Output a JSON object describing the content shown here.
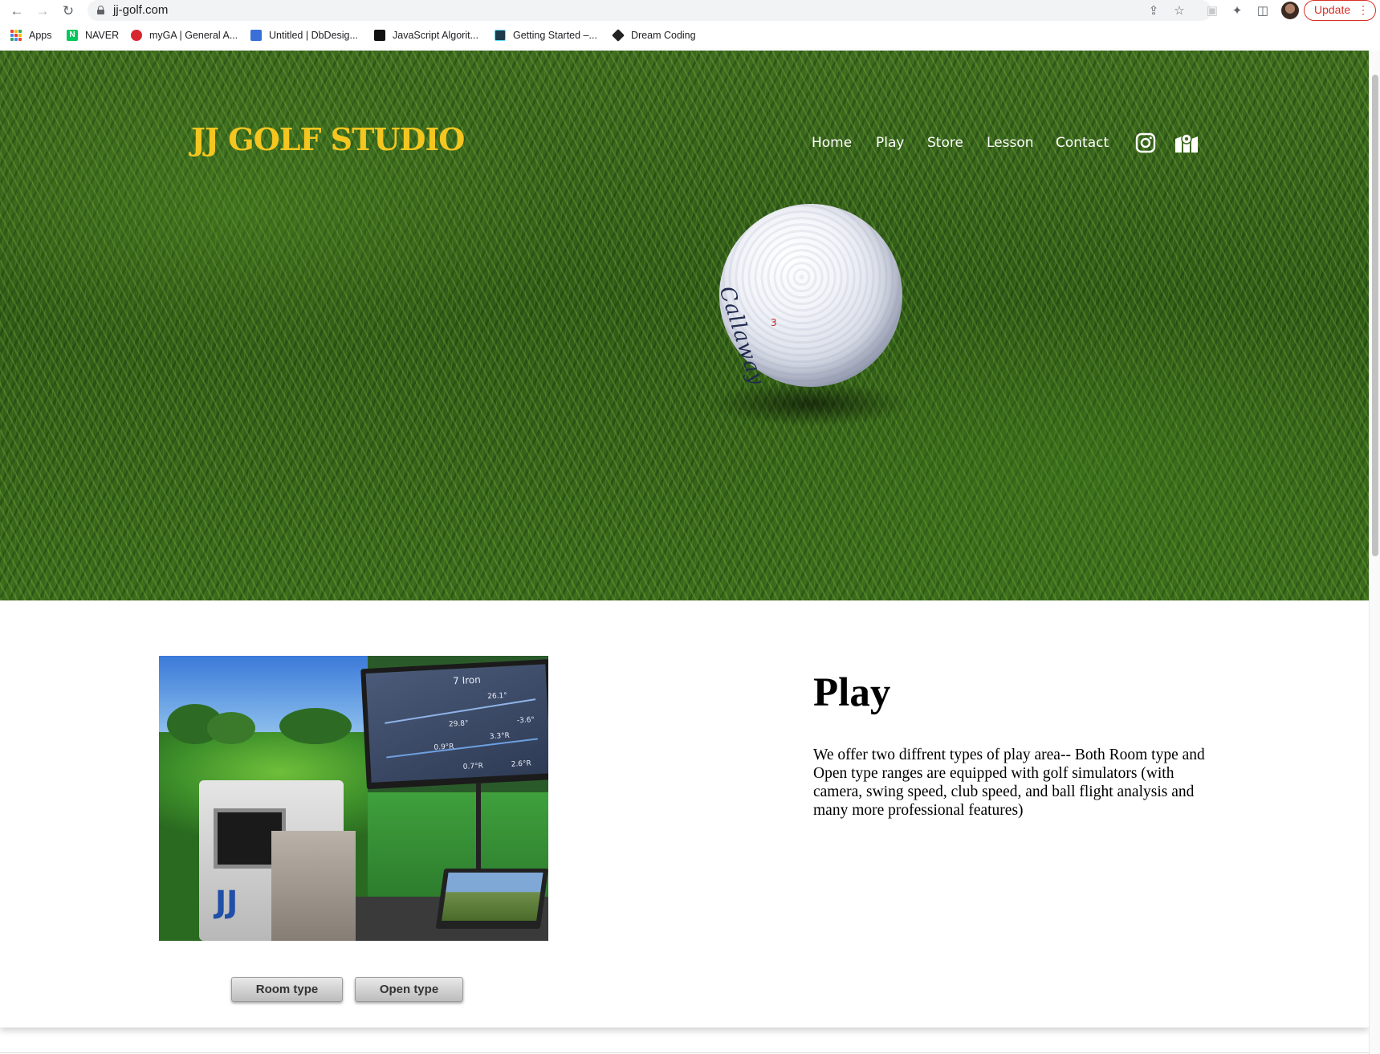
{
  "browser": {
    "url": "jj-golf.com",
    "update_label": "Update",
    "bookmarks": [
      {
        "label": "Apps"
      },
      {
        "label": "NAVER"
      },
      {
        "label": "myGA | General A..."
      },
      {
        "label": "Untitled | DbDesig..."
      },
      {
        "label": "JavaScript Algorit..."
      },
      {
        "label": "Getting Started –..."
      },
      {
        "label": "Dream Coding"
      }
    ]
  },
  "site": {
    "logo": "JJ GOLF STUDIO",
    "nav": [
      {
        "label": "Home"
      },
      {
        "label": "Play"
      },
      {
        "label": "Store"
      },
      {
        "label": "Lesson"
      },
      {
        "label": "Contact"
      }
    ],
    "nav_icons": [
      "instagram-icon",
      "map-icon"
    ],
    "colors": {
      "logo": "#f4c61f",
      "nav_text": "#ffffff"
    },
    "hero": {
      "ball_brand": "Callaway",
      "ball_number": "3"
    }
  },
  "play": {
    "title": "Play",
    "description": "We offer two diffrent types of play area-- Both Room type and Open type ranges are equipped with golf simulators (with camera, swing speed, club speed, and ball flight analysis and many more professional features)",
    "buttons": {
      "room": "Room type",
      "open": "Open type"
    },
    "simulator_screen": {
      "title": "7 Iron",
      "readouts": [
        "26.1°",
        "29.8°",
        "-3.6°",
        "3.3°R",
        "0.9°R",
        "0.7°R",
        "2.6°R"
      ]
    }
  }
}
